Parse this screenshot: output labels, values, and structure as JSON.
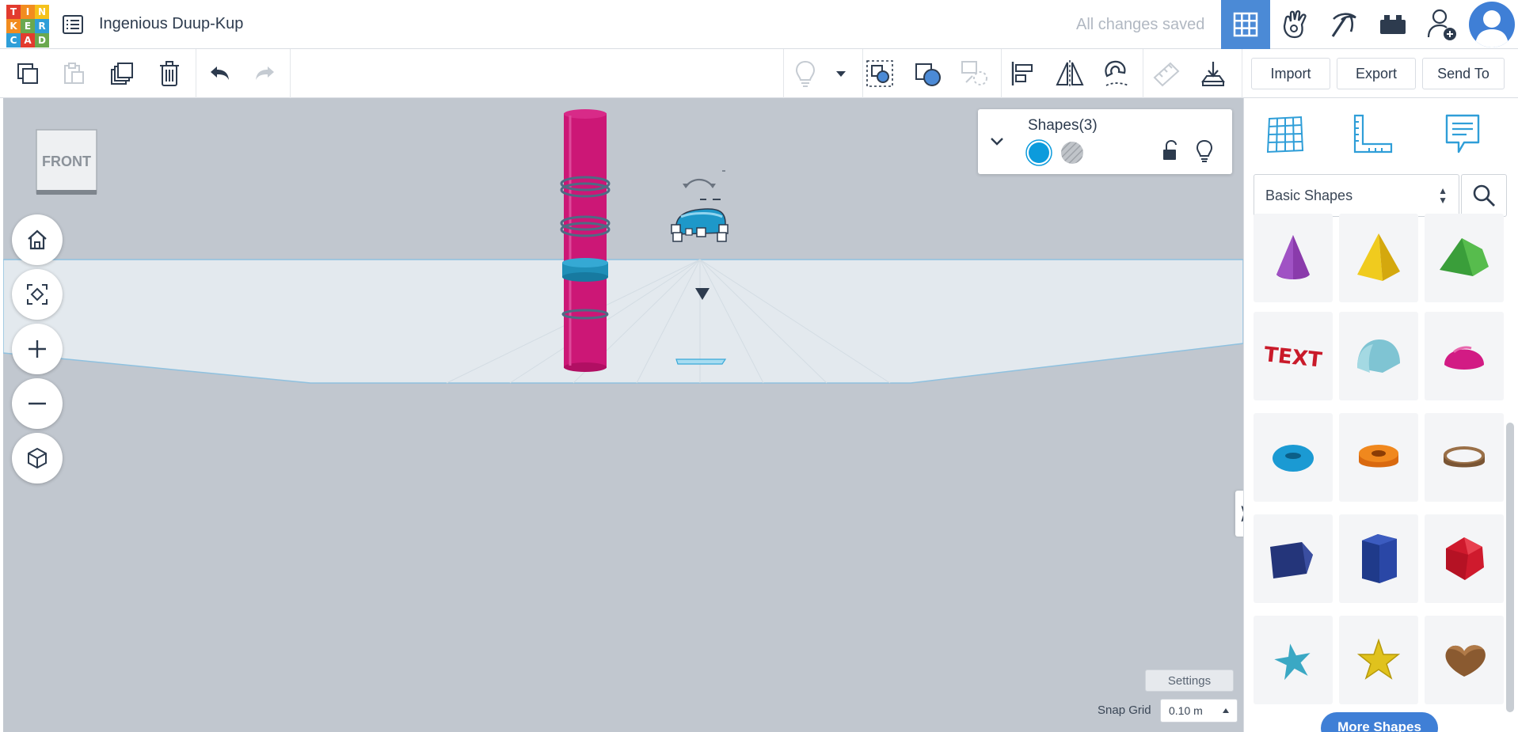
{
  "app": {
    "logo_letters": [
      "T",
      "I",
      "N",
      "K",
      "E",
      "R",
      "C",
      "A",
      "D"
    ],
    "logo_colors": [
      "#e23b2e",
      "#f28c1f",
      "#f5c21b",
      "#f28c1f",
      "#6aa84f",
      "#2f9ed8",
      "#2f9ed8",
      "#e23b2e",
      "#6aa84f"
    ],
    "accent": "#4b8ad6"
  },
  "header": {
    "project_title": "Ingenious Duup-Kup",
    "save_status": "All changes saved",
    "buttons": [
      "grid-view-icon",
      "tinker-hand-icon",
      "pickaxe-icon",
      "brick-icon",
      "add-user-icon"
    ]
  },
  "toolbar": {
    "left_tools": [
      "copy-icon",
      "paste-icon",
      "duplicate-icon",
      "trash-icon",
      "undo-icon",
      "redo-icon"
    ],
    "right_tools": [
      "light-bulb-icon",
      "dropdown-arrow-icon",
      "group-icon",
      "ungroup-icon",
      "workplane-tool-icon",
      "align-icon",
      "mirror-icon",
      "magnet-icon",
      "ruler-tool-icon",
      "import-arrow-icon"
    ],
    "import_label": "Import",
    "export_label": "Export",
    "send_to_label": "Send To"
  },
  "viewport": {
    "viewcube_label": "FRONT",
    "nav_buttons": [
      "home-icon",
      "fit-view-icon",
      "zoom-in-icon",
      "zoom-out-icon",
      "perspective-icon"
    ],
    "shapes_panel": {
      "title": "Shapes(3)",
      "solid_color": "#0c9bdc",
      "hole_pattern": "striped gray"
    },
    "settings_label": "Settings",
    "snap_grid_label": "Snap Grid",
    "snap_grid_value": "0.10 m",
    "collapse_label": "⟩"
  },
  "right_panel": {
    "tabs": [
      "workplane-grid-icon",
      "ruler-icon",
      "notes-icon"
    ],
    "library": "Basic Shapes",
    "shapes": [
      "cone",
      "pyramid",
      "roof",
      "text",
      "half-cylinder",
      "half-sphere",
      "torus",
      "tube",
      "ring",
      "polygon-wedge",
      "hexagonal-prism",
      "icosahedron",
      "star-thin",
      "star",
      "heart"
    ],
    "more_shapes_label": "More Shapes"
  }
}
